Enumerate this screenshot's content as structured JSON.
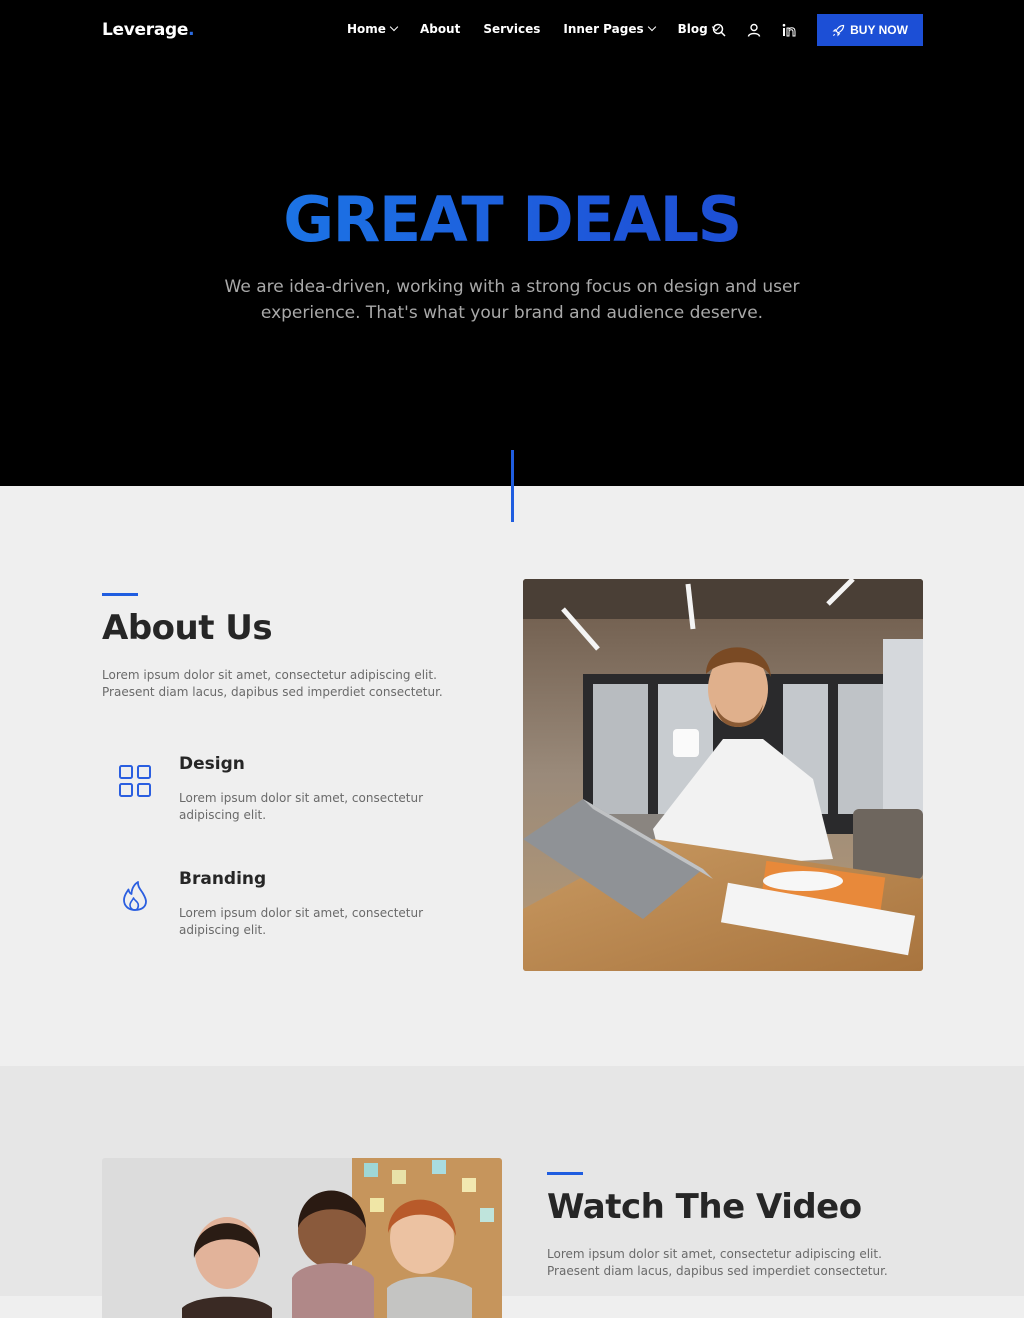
{
  "brand": {
    "name": "Leverage",
    "dot": ".",
    "accent": "#1f5de0"
  },
  "nav": {
    "items": [
      {
        "label": "Home",
        "dropdown": true
      },
      {
        "label": "About",
        "dropdown": false
      },
      {
        "label": "Services",
        "dropdown": false
      },
      {
        "label": "Inner Pages",
        "dropdown": true
      },
      {
        "label": "Blog",
        "dropdown": true
      }
    ],
    "icons": [
      "search-icon",
      "user-icon",
      "linkedin-icon"
    ],
    "cta_label": "BUY NOW"
  },
  "hero": {
    "title": "GREAT DEALS",
    "subtitle": "We are idea-driven, working with a strong focus on design and user experience. That's what your brand and audience deserve."
  },
  "about": {
    "title": "About Us",
    "text": "Lorem ipsum dolor sit amet, consectetur adipiscing elit. Praesent diam lacus, dapibus sed imperdiet consectetur.",
    "features": [
      {
        "title": "Design",
        "text": "Lorem ipsum dolor sit amet, consectetur adipiscing elit.",
        "icon": "grid-icon"
      },
      {
        "title": "Branding",
        "text": "Lorem ipsum dolor sit amet, consectetur adipiscing elit.",
        "icon": "flame-icon"
      }
    ]
  },
  "video": {
    "title": "Watch The Video",
    "text": "Lorem ipsum dolor sit amet, consectetur adipiscing elit. Praesent diam lacus, dapibus sed imperdiet consectetur."
  }
}
